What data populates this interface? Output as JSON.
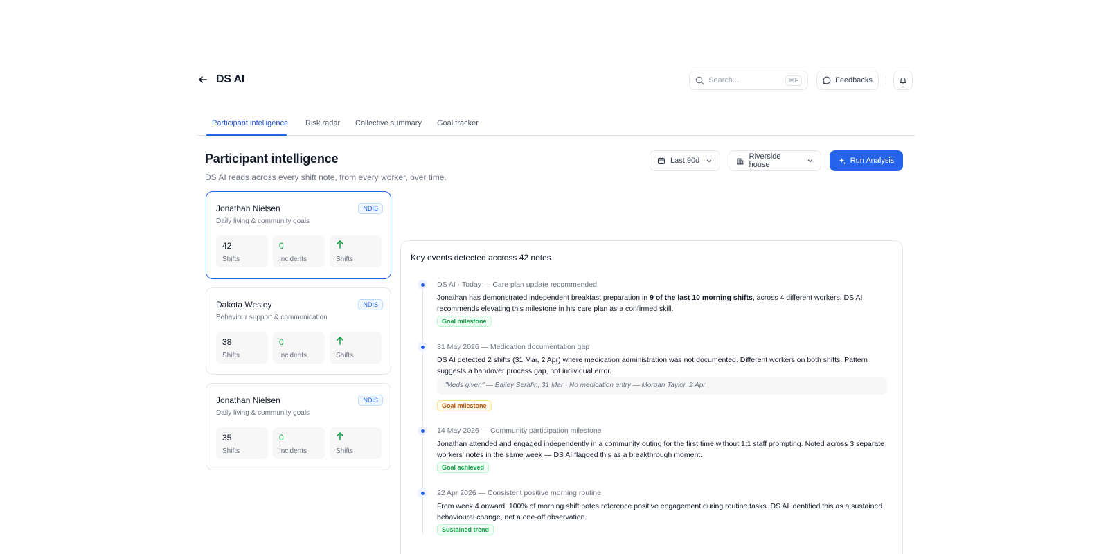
{
  "header": {
    "title": "DS AI",
    "search_placeholder": "Search...",
    "search_shortcut": "⌘F",
    "feedback_label": "Feedbacks"
  },
  "tabs": [
    {
      "label": "Participant intelligence",
      "active": true
    },
    {
      "label": "Risk radar",
      "active": false
    },
    {
      "label": "Collective summary",
      "active": false
    },
    {
      "label": "Goal tracker",
      "active": false
    }
  ],
  "page": {
    "title": "Participant intelligence",
    "subtitle": "DS AI reads across every shift note, from every worker, over time."
  },
  "filters": {
    "range_label": "Last 90d",
    "house_label": "Riverside house",
    "run_label": "Run Analysis"
  },
  "participants": [
    {
      "name": "Jonathan Nielsen",
      "badge": "NDIS",
      "goal": "Daily living & community goals",
      "shifts": "42",
      "shifts_label": "Shifts",
      "incidents": "0",
      "incidents_label": "Incidents",
      "trend_label": "Shifts",
      "selected": true
    },
    {
      "name": "Dakota Wesley",
      "badge": "NDIS",
      "goal": "Behaviour support & communication",
      "shifts": "38",
      "shifts_label": "Shifts",
      "incidents": "0",
      "incidents_label": "Incidents",
      "trend_label": "Shifts",
      "selected": false
    },
    {
      "name": "Jonathan Nielsen",
      "badge": "NDIS",
      "goal": "Daily living & community goals",
      "shifts": "35",
      "shifts_label": "Shifts",
      "incidents": "0",
      "incidents_label": "Incidents",
      "trend_label": "Shifts",
      "selected": false
    }
  ],
  "events_panel": {
    "heading": "Key events detected accross 42 notes",
    "events": [
      {
        "meta": "DS AI · Today — Care plan update recommended",
        "body_pre": "Jonathan has demonstrated independent breakfast preparation in ",
        "body_bold": "9 of the last 10 morning shifts",
        "body_post": ", across 4 different workers. DS AI recommends elevating this milestone in his care plan as a confirmed skill.",
        "tag": "Goal milestone",
        "tag_color": "#16a34a"
      },
      {
        "meta": "31 May 2026 — Medication documentation gap",
        "body": "DS AI detected 2 shifts (31 Mar, 2 Apr) where medication administration was not documented. Different workers on both shifts. Pattern suggests a handover process gap, not individual error.",
        "quote": "\"Meds given\" — Bailey Serafin, 31 Mar · No medication entry — Morgan Taylor, 2 Apr",
        "tag": "Goal milestone",
        "tag_color": "#b45309"
      },
      {
        "meta": "14 May 2026 — Community participation milestone",
        "body": "Jonathan attended and engaged independently in a community outing for the first time without 1:1 staff prompting. Noted across 3 separate workers' notes in the same week — DS AI flagged this as a breakthrough moment.",
        "tag": "Goal achieved",
        "tag_color": "#16a34a"
      },
      {
        "meta": "22 Apr 2026 — Consistent positive morning routine",
        "body": "From week 4 onward, 100% of morning shift notes reference positive engagement during routine tasks. DS AI identified this as a sustained behavioural change, not a one-off observation.",
        "tag": "Sustained trend",
        "tag_color": "#16a34a"
      }
    ]
  },
  "colors": {
    "accent": "#2563eb",
    "positive": "#16a34a",
    "warning": "#b45309"
  },
  "icons": {
    "back": "arrow-left-icon",
    "search": "search-icon",
    "feedback": "message-circle-icon",
    "bell": "bell-icon",
    "calendar": "calendar-icon",
    "building": "building-icon",
    "chevron": "chevron-down-icon",
    "sparkle": "sparkle-icon",
    "trend": "arrow-up-icon"
  }
}
